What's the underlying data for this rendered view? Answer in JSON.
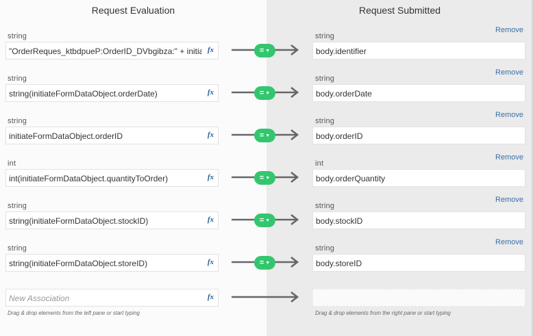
{
  "panes": {
    "left_title": "Request Evaluation",
    "right_title": "Request Submitted"
  },
  "mappings": [
    {
      "source_type": "string",
      "source_expr": "\"OrderReques_ktbdpueP:OrderID_DVbgibza:\" + initiat",
      "fx": "fx",
      "operator": "=",
      "target_type": "string",
      "target": "body.identifier",
      "remove_label": "Remove"
    },
    {
      "source_type": "string",
      "source_expr": "string(initiateFormDataObject.orderDate)",
      "fx": "fx",
      "operator": "=",
      "target_type": "string",
      "target": "body.orderDate",
      "remove_label": "Remove"
    },
    {
      "source_type": "string",
      "source_expr": "initiateFormDataObject.orderID",
      "fx": "fx",
      "operator": "=",
      "target_type": "string",
      "target": "body.orderID",
      "remove_label": "Remove"
    },
    {
      "source_type": "int",
      "source_expr": "int(initiateFormDataObject.quantityToOrder)",
      "fx": "fx",
      "operator": "=",
      "target_type": "int",
      "target": "body.orderQuantity",
      "remove_label": "Remove"
    },
    {
      "source_type": "string",
      "source_expr": "string(initiateFormDataObject.stockID)",
      "fx": "fx",
      "operator": "=",
      "target_type": "string",
      "target": "body.stockID",
      "remove_label": "Remove"
    },
    {
      "source_type": "string",
      "source_expr": "string(initiateFormDataObject.storeID)",
      "fx": "fx",
      "operator": "=",
      "target_type": "string",
      "target": "body.storeID",
      "remove_label": "Remove"
    }
  ],
  "new_association": {
    "placeholder": "New Association",
    "fx": "fx",
    "left_hint": "Drag & drop elements from the left pane or start typing",
    "right_hint": "Drag & drop elements from the right pane or start typing"
  },
  "colors": {
    "operator_pill": "#34c66f",
    "remove_link": "#3a6fa8",
    "fx_icon": "#2c5d91",
    "arrow": "#666666"
  },
  "icons": {
    "operator_dropdown": "caret-down-icon",
    "connector": "right-arrow-icon",
    "expression_editor": "fx-icon"
  }
}
